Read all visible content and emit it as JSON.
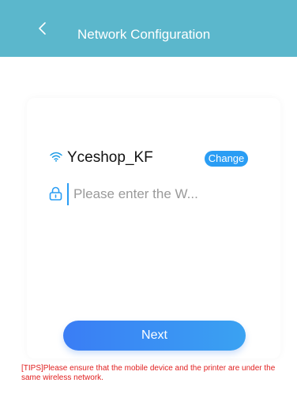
{
  "header": {
    "title": "Network Configuration",
    "back_icon": "chevron-left-icon",
    "background_color": "#5bb7cc"
  },
  "network": {
    "ssid": "Yceshop_KF",
    "wifi_icon": "wifi-icon",
    "change_label": "Change",
    "change_color": "#2a9df4"
  },
  "password": {
    "lock_icon": "lock-icon",
    "value": "",
    "placeholder": "Please enter the W..."
  },
  "actions": {
    "next_label": "Next"
  },
  "tips": {
    "text": "[TIPS]Please ensure that the mobile device and the printer are under the same wireless network.",
    "color": "#e02020"
  }
}
